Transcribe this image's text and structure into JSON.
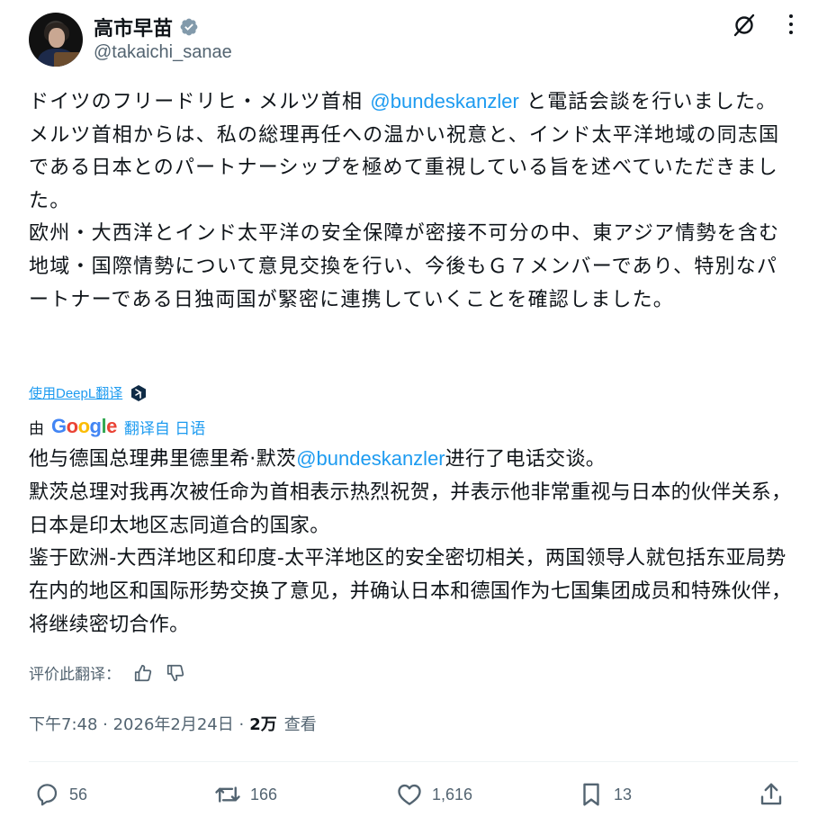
{
  "author": {
    "name": "高市早苗",
    "handle": "@takaichi_sanae"
  },
  "post": {
    "original": {
      "p1_a": "ドイツのフリードリヒ・メルツ首相 ",
      "p1_mention": "@bundeskanzler",
      "p1_b": " と電話会談を行いました。",
      "p2": "メルツ首相からは、私の総理再任への温かい祝意と、インド太平洋地域の同志国である日本とのパートナーシップを極めて重視している旨を述べていただきました。",
      "p3": "欧州・大西洋とインド太平洋の安全保障が密接不可分の中、東アジア情勢を含む地域・国際情勢について意見交換を行い、今後もＧ７メンバーであり、特別なパートナーである日独両国が緊密に連携していくことを確認しました。"
    },
    "deepl_link": "使用DeepL翻译",
    "translation_by": "由",
    "google": [
      "G",
      "o",
      "o",
      "g",
      "l",
      "e"
    ],
    "translated_from": "翻译自 日语",
    "translation": {
      "p1_a": "他与德国总理弗里德里希·默茨",
      "p1_mention": "@bundeskanzler",
      "p1_b": "进行了电话交谈。",
      "p2": "默茨总理对我再次被任命为首相表示热烈祝贺，并表示他非常重视与日本的伙伴关系，日本是印太地区志同道合的国家。",
      "p3": "鉴于欧洲-大西洋地区和印度-太平洋地区的安全密切相关，两国领导人就包括东亚局势在内的地区和国际形势交换了意见，并确认日本和德国作为七国集团成员和特殊伙伴，将继续密切合作。"
    },
    "rate_label": "评价此翻译：",
    "time": "下午7:48 · 2026年2月24日 · ",
    "views": "2万",
    "views_label": "查看"
  },
  "actions": {
    "replies": "56",
    "reposts": "166",
    "likes": "1,616",
    "bookmarks": "13"
  },
  "colors": {
    "accent": "#1d9bf0",
    "secondary_text": "#536471",
    "verified": "#829aab",
    "google": [
      "#4285f4",
      "#ea4335",
      "#fbbc05",
      "#4285f4",
      "#34a853",
      "#ea4335"
    ]
  },
  "icons": [
    "verified-icon",
    "grok-icon",
    "more-icon",
    "deepl-icon",
    "thumbs-up-icon",
    "thumbs-down-icon",
    "reply-icon",
    "repost-icon",
    "like-icon",
    "bookmark-icon",
    "share-icon"
  ]
}
